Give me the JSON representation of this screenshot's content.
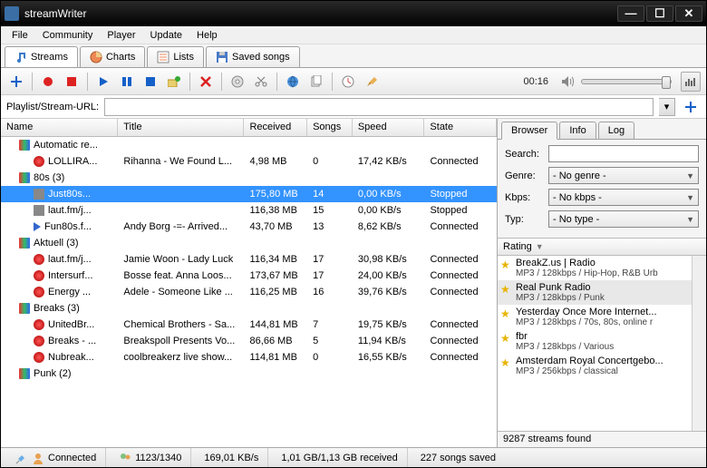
{
  "window": {
    "title": "streamWriter"
  },
  "menu": [
    "File",
    "Community",
    "Player",
    "Update",
    "Help"
  ],
  "module_tabs": [
    {
      "label": "Streams",
      "icon": "note"
    },
    {
      "label": "Charts",
      "icon": "chart"
    },
    {
      "label": "Lists",
      "icon": "list"
    },
    {
      "label": "Saved songs",
      "icon": "disk"
    }
  ],
  "toolbar": {
    "time": "00:16",
    "url_label": "Playlist/Stream-URL:",
    "url_value": ""
  },
  "columns": [
    "Name",
    "Title",
    "Received",
    "Songs",
    "Speed",
    "State"
  ],
  "tree": [
    {
      "type": "group",
      "name": "Automatic re...",
      "title": "",
      "recv": "",
      "songs": "",
      "speed": "",
      "state": ""
    },
    {
      "type": "rec",
      "indent": 2,
      "name": "LOLLIRA...",
      "title": "Rihanna - We Found L...",
      "recv": "4,98 MB",
      "songs": "0",
      "speed": "17,42 KB/s",
      "state": "Connected"
    },
    {
      "type": "group",
      "name": "80s (3)",
      "title": "",
      "recv": "",
      "songs": "",
      "speed": "",
      "state": ""
    },
    {
      "type": "stop",
      "indent": 2,
      "sel": true,
      "name": "Just80s...",
      "title": "",
      "recv": "175,80 MB",
      "songs": "14",
      "speed": "0,00 KB/s",
      "state": "Stopped"
    },
    {
      "type": "stop",
      "indent": 2,
      "name": "laut.fm/j...",
      "title": "",
      "recv": "116,38 MB",
      "songs": "15",
      "speed": "0,00 KB/s",
      "state": "Stopped"
    },
    {
      "type": "play",
      "indent": 2,
      "name": "Fun80s.f...",
      "title": "Andy Borg -=- Arrived...",
      "recv": "43,70 MB",
      "songs": "13",
      "speed": "8,62 KB/s",
      "state": "Connected"
    },
    {
      "type": "group",
      "name": "Aktuell (3)",
      "title": "",
      "recv": "",
      "songs": "",
      "speed": "",
      "state": ""
    },
    {
      "type": "rec",
      "indent": 2,
      "name": "laut.fm/j...",
      "title": "Jamie Woon - Lady Luck",
      "recv": "116,34 MB",
      "songs": "17",
      "speed": "30,98 KB/s",
      "state": "Connected"
    },
    {
      "type": "rec",
      "indent": 2,
      "name": "Intersurf...",
      "title": "Bosse feat. Anna Loos...",
      "recv": "173,67 MB",
      "songs": "17",
      "speed": "24,00 KB/s",
      "state": "Connected"
    },
    {
      "type": "rec",
      "indent": 2,
      "name": "Energy ...",
      "title": "Adele - Someone Like ...",
      "recv": "116,25 MB",
      "songs": "16",
      "speed": "39,76 KB/s",
      "state": "Connected"
    },
    {
      "type": "group",
      "name": "Breaks (3)",
      "title": "",
      "recv": "",
      "songs": "",
      "speed": "",
      "state": ""
    },
    {
      "type": "rec",
      "indent": 2,
      "name": "UnitedBr...",
      "title": "Chemical Brothers - Sa...",
      "recv": "144,81 MB",
      "songs": "7",
      "speed": "19,75 KB/s",
      "state": "Connected"
    },
    {
      "type": "rec",
      "indent": 2,
      "name": "Breaks - ...",
      "title": "Breakspoll Presents Vo...",
      "recv": "86,66 MB",
      "songs": "5",
      "speed": "11,94 KB/s",
      "state": "Connected"
    },
    {
      "type": "rec",
      "indent": 2,
      "name": "Nubreak...",
      "title": "coolbreakerz live show...",
      "recv": "114,81 MB",
      "songs": "0",
      "speed": "16,55 KB/s",
      "state": "Connected"
    },
    {
      "type": "group",
      "name": "Punk (2)",
      "title": "",
      "recv": "",
      "songs": "",
      "speed": "",
      "state": ""
    }
  ],
  "browser": {
    "tabs": [
      "Browser",
      "Info",
      "Log"
    ],
    "fields": {
      "search_label": "Search:",
      "search_value": "",
      "genre_label": "Genre:",
      "genre_value": "- No genre -",
      "kbps_label": "Kbps:",
      "kbps_value": "- No kbps -",
      "typ_label": "Typ:",
      "typ_value": "- No type -"
    },
    "list_header": "Rating",
    "items": [
      {
        "name": "BreakZ.us | Radio",
        "desc": "MP3 / 128kbps / Hip-Hop, R&B Urb"
      },
      {
        "name": "Real Punk Radio",
        "desc": "MP3 / 128kbps / Punk",
        "sel": true
      },
      {
        "name": "Yesterday Once More Internet...",
        "desc": "MP3 / 128kbps / 70s, 80s, online r"
      },
      {
        "name": "fbr",
        "desc": "MP3 / 128kbps / Various"
      },
      {
        "name": "Amsterdam Royal Concertgebo...",
        "desc": "MP3 / 256kbps / classical"
      }
    ],
    "footer": "9287 streams found"
  },
  "status": {
    "connected": "Connected",
    "clients": "1123/1340",
    "speed": "169,01 KB/s",
    "received": "1,01 GB/1,13 GB received",
    "songs": "227 songs saved"
  }
}
